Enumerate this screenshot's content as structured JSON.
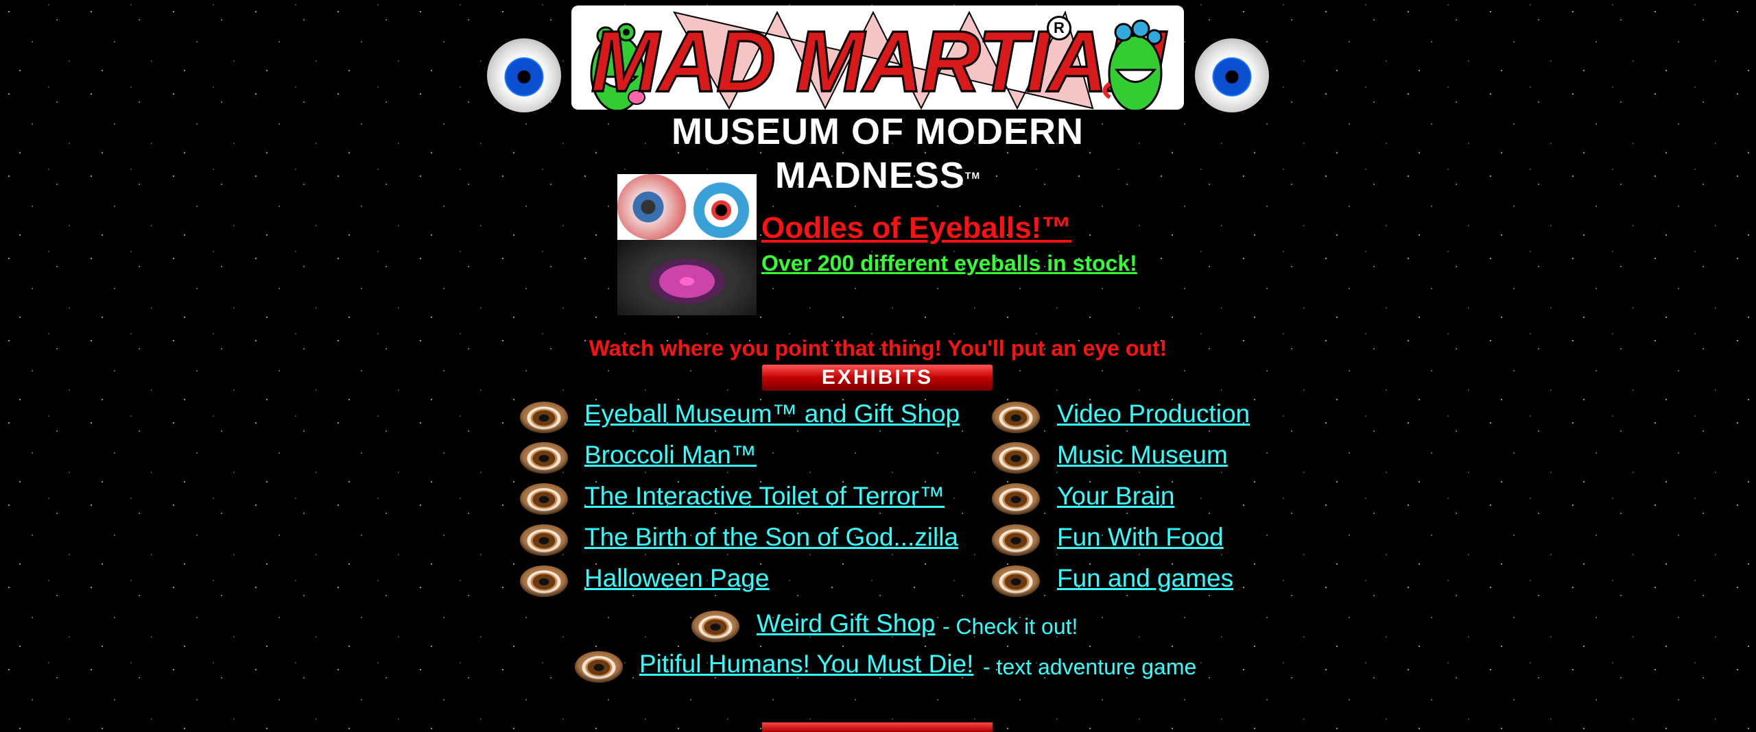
{
  "header": {
    "logo_title": "MAD MARTIAN",
    "logo_registered": "R",
    "logo_subtitle": "MUSEUM OF MODERN MADNESS",
    "logo_subtitle_tm": "TM"
  },
  "feature": {
    "title": "Oodles of Eyeballs!™",
    "subtitle": "Over 200 different eyeballs in stock!"
  },
  "warning": "Watch where you point that thing! You'll put an eye out!",
  "exhibits_banner": "EXHIBITS",
  "exhibits": {
    "left": [
      {
        "label": "Eyeball Museum™ and Gift Shop"
      },
      {
        "label": "Broccoli Man™"
      },
      {
        "label": "The Interactive Toilet of Terror™"
      },
      {
        "label": "The Birth of the Son of God...zilla"
      },
      {
        "label": "Halloween Page"
      }
    ],
    "right": [
      {
        "label": "Video Production"
      },
      {
        "label": "Music Museum"
      },
      {
        "label": "Your Brain"
      },
      {
        "label": "Fun With Food"
      },
      {
        "label": "Fun and games"
      }
    ],
    "extra": [
      {
        "label": "Weird Gift Shop",
        "desc": "- Check it out!"
      },
      {
        "label": "Pitiful Humans! You Must Die!",
        "desc": "- text adventure game"
      }
    ]
  },
  "colors": {
    "link": "#33ffff",
    "title_red": "#ff1111",
    "subtitle_green": "#33ff33",
    "background": "#000000"
  }
}
